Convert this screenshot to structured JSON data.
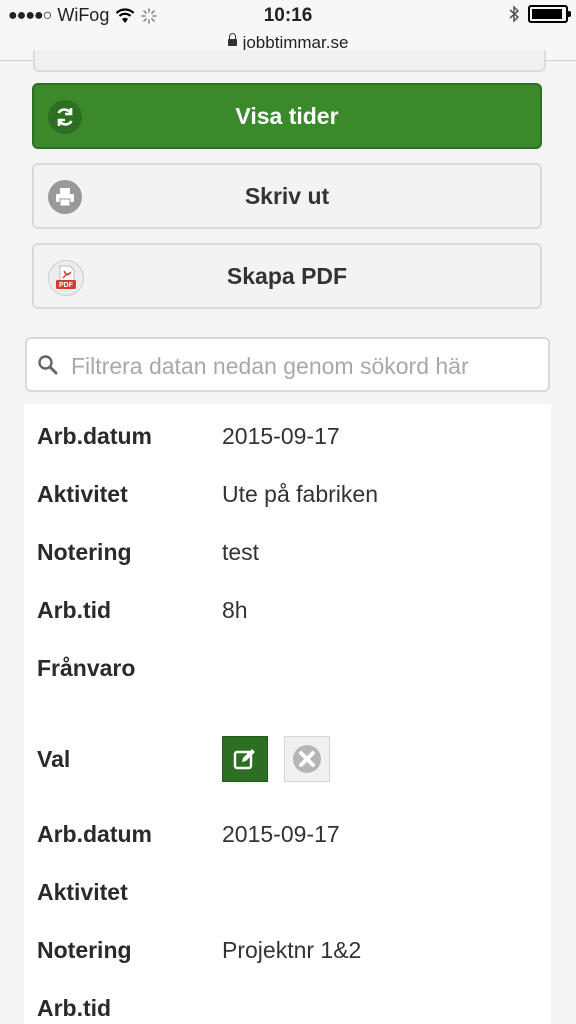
{
  "status": {
    "signal": "●●●●○",
    "carrier": "WiFog",
    "time": "10:16"
  },
  "browser": {
    "url": "jobbtimmar.se"
  },
  "buttons": {
    "show_times": "Visa tider",
    "print": "Skriv ut",
    "pdf": "Skapa PDF",
    "pdf_icon_text": "PDF"
  },
  "search": {
    "placeholder": "Filtrera datan nedan genom sökord här"
  },
  "records": [
    {
      "date_label": "Arb.datum",
      "date": "2015-09-17",
      "activity_label": "Aktivitet",
      "activity": "Ute på fabriken",
      "note_label": "Notering",
      "note": "test",
      "time_label": "Arb.tid",
      "time": "8h",
      "absence_label": "Frånvaro",
      "absence": "",
      "choice_label": "Val"
    },
    {
      "date_label": "Arb.datum",
      "date": "2015-09-17",
      "activity_label": "Aktivitet",
      "activity": "",
      "note_label": "Notering",
      "note": "Projektnr 1&2",
      "time_label": "Arb.tid",
      "time": ""
    }
  ],
  "colors": {
    "accent_green": "#3a8a2c",
    "dark_green": "#2d6f22"
  },
  "icons": [
    "wifi-icon",
    "loading-spinner-icon",
    "bluetooth-icon",
    "battery-icon",
    "lock-icon",
    "refresh-icon",
    "printer-icon",
    "pdf-icon",
    "search-icon",
    "edit-icon",
    "delete-icon"
  ]
}
